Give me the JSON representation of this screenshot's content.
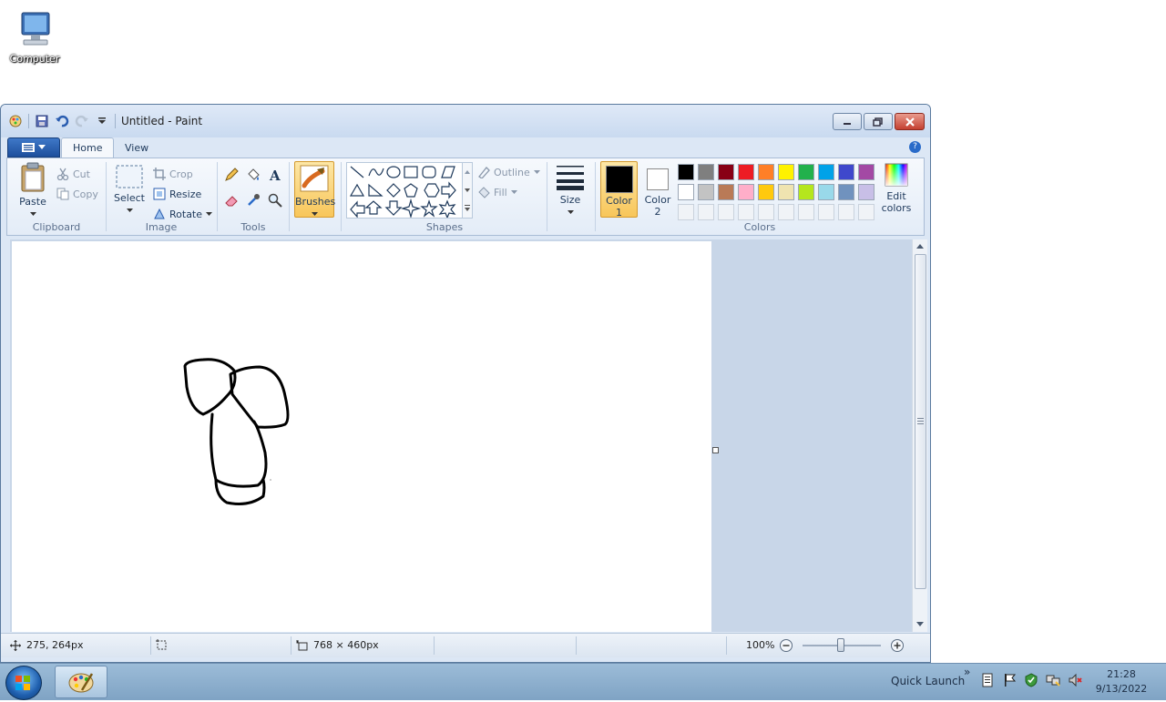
{
  "desktop": {
    "icon_label": "Computer"
  },
  "window": {
    "title": "Untitled - Paint"
  },
  "tabs": {
    "home": "Home",
    "view": "View"
  },
  "clipboard": {
    "paste": "Paste",
    "cut": "Cut",
    "copy": "Copy",
    "group": "Clipboard"
  },
  "image": {
    "select": "Select",
    "crop": "Crop",
    "resize": "Resize",
    "rotate": "Rotate",
    "group": "Image"
  },
  "tools": {
    "group": "Tools"
  },
  "brushes": {
    "label": "Brushes"
  },
  "shapes": {
    "outline": "Outline",
    "fill": "Fill",
    "group": "Shapes"
  },
  "size": {
    "label": "Size"
  },
  "colors": {
    "color1": "Color",
    "color1_num": "1",
    "color2": "Color",
    "color2_num": "2",
    "edit_line1": "Edit",
    "edit_line2": "colors",
    "group": "Colors",
    "color1_value": "#000000",
    "color2_value": "#ffffff",
    "palette_row1": [
      "#000000",
      "#7f7f7f",
      "#880015",
      "#ed1c24",
      "#ff7f27",
      "#fff200",
      "#22b14c",
      "#00a2e8",
      "#3f48cc",
      "#a349a4"
    ],
    "palette_row2": [
      "#ffffff",
      "#c3c3c3",
      "#b97a57",
      "#ffaec9",
      "#ffc90e",
      "#efe4b0",
      "#b5e61d",
      "#99d9ea",
      "#7092be",
      "#c8bfe7"
    ]
  },
  "status": {
    "cursor_pos": "275, 264px",
    "image_size": "768 × 460px",
    "zoom": "100%"
  },
  "taskbar": {
    "quick_launch": "Quick Launch",
    "chevron": "»",
    "time": "21:28",
    "date": "9/13/2022"
  }
}
